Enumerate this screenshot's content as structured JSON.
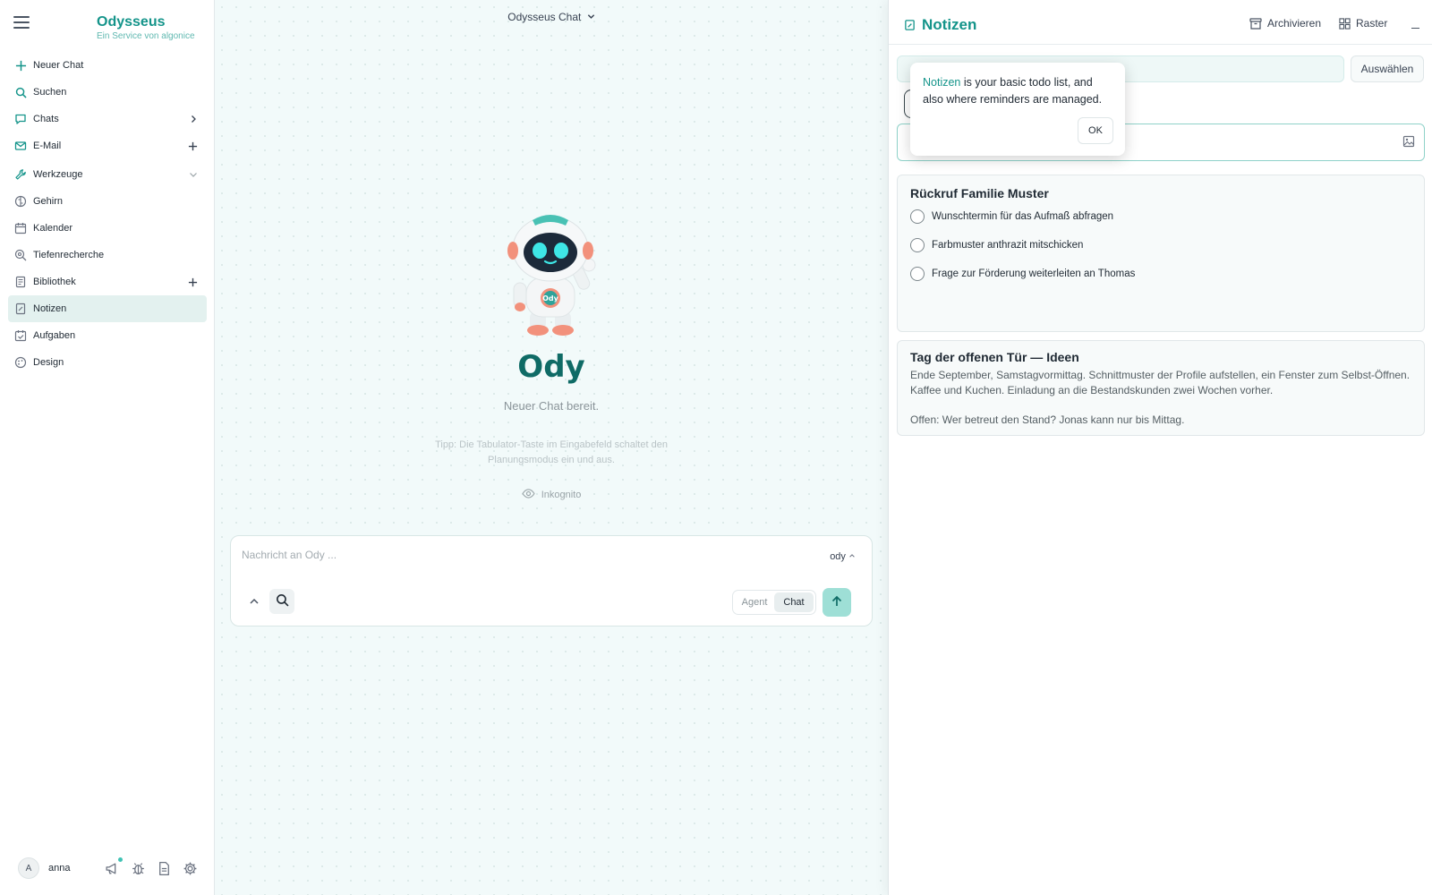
{
  "sidebar": {
    "brand_title": "Odysseus",
    "brand_subtitle": "Ein Service von algonice",
    "items": [
      {
        "label": "Neuer Chat",
        "icon": "plus-icon"
      },
      {
        "label": "Suchen",
        "icon": "search-icon"
      },
      {
        "label": "Chats",
        "icon": "chat-bubble-icon",
        "trail": "chevron-right-icon"
      },
      {
        "label": "E-Mail",
        "icon": "mail-icon",
        "trail": "plus-icon"
      },
      {
        "label": "Werkzeuge",
        "icon": "wrench-icon",
        "trail": "chevron-down-icon"
      },
      {
        "label": "Gehirn",
        "icon": "brain-icon"
      },
      {
        "label": "Kalender",
        "icon": "calendar-icon"
      },
      {
        "label": "Tiefenrecherche",
        "icon": "deep-search-icon"
      },
      {
        "label": "Bibliothek",
        "icon": "library-icon",
        "trail": "plus-icon"
      },
      {
        "label": "Notizen",
        "icon": "note-icon",
        "active": true
      },
      {
        "label": "Aufgaben",
        "icon": "tasks-icon"
      },
      {
        "label": "Design",
        "icon": "palette-icon"
      }
    ],
    "user": {
      "initial": "A",
      "name": "anna"
    },
    "footer_icons": [
      "megaphone-icon",
      "bug-icon",
      "document-icon",
      "settings-icon"
    ]
  },
  "chat": {
    "title": "Odysseus Chat",
    "assistant_name": "Ody",
    "ready_text": "Neuer Chat bereit.",
    "tip": "Tipp: Die Tabulator-Taste im Eingabefeld schaltet den Planungsmodus ein und aus.",
    "incognito_label": "Inkognito",
    "composer": {
      "placeholder": "Nachricht an Ody ...",
      "model": "ody",
      "mode_agent": "Agent",
      "mode_chat": "Chat",
      "active_mode": "Chat"
    }
  },
  "notes_panel": {
    "title": "Notizen",
    "archive_label": "Archivieren",
    "grid_label": "Raster",
    "select_label": "Auswählen",
    "tooltip": {
      "highlight": "Notizen",
      "text": " is your basic todo list, and also where reminders are managed.",
      "ok_label": "OK"
    },
    "notes": [
      {
        "title": "Rückruf Familie Muster",
        "todos": [
          "Wunschtermin für das Aufmaß abfragen",
          "Farbmuster anthrazit mitschicken",
          "Frage zur Förderung weiterleiten an Thomas"
        ]
      },
      {
        "title": "Tag der offenen Tür — Ideen",
        "body": [
          "Ende September, Samstagvormittag. Schnittmuster der Profile aufstellen, ein Fenster zum Selbst-Öffnen. Kaffee und Kuchen. Einladung an die Bestandskunden zwei Wochen vorher.",
          "Offen: Wer betreut den Stand? Jonas kann nur bis Mittag."
        ]
      }
    ]
  },
  "colors": {
    "accent": "#14948a",
    "accent_dark": "#0f6b66",
    "active_bg": "#e3f1ef",
    "send_bg": "#9edfd6"
  }
}
